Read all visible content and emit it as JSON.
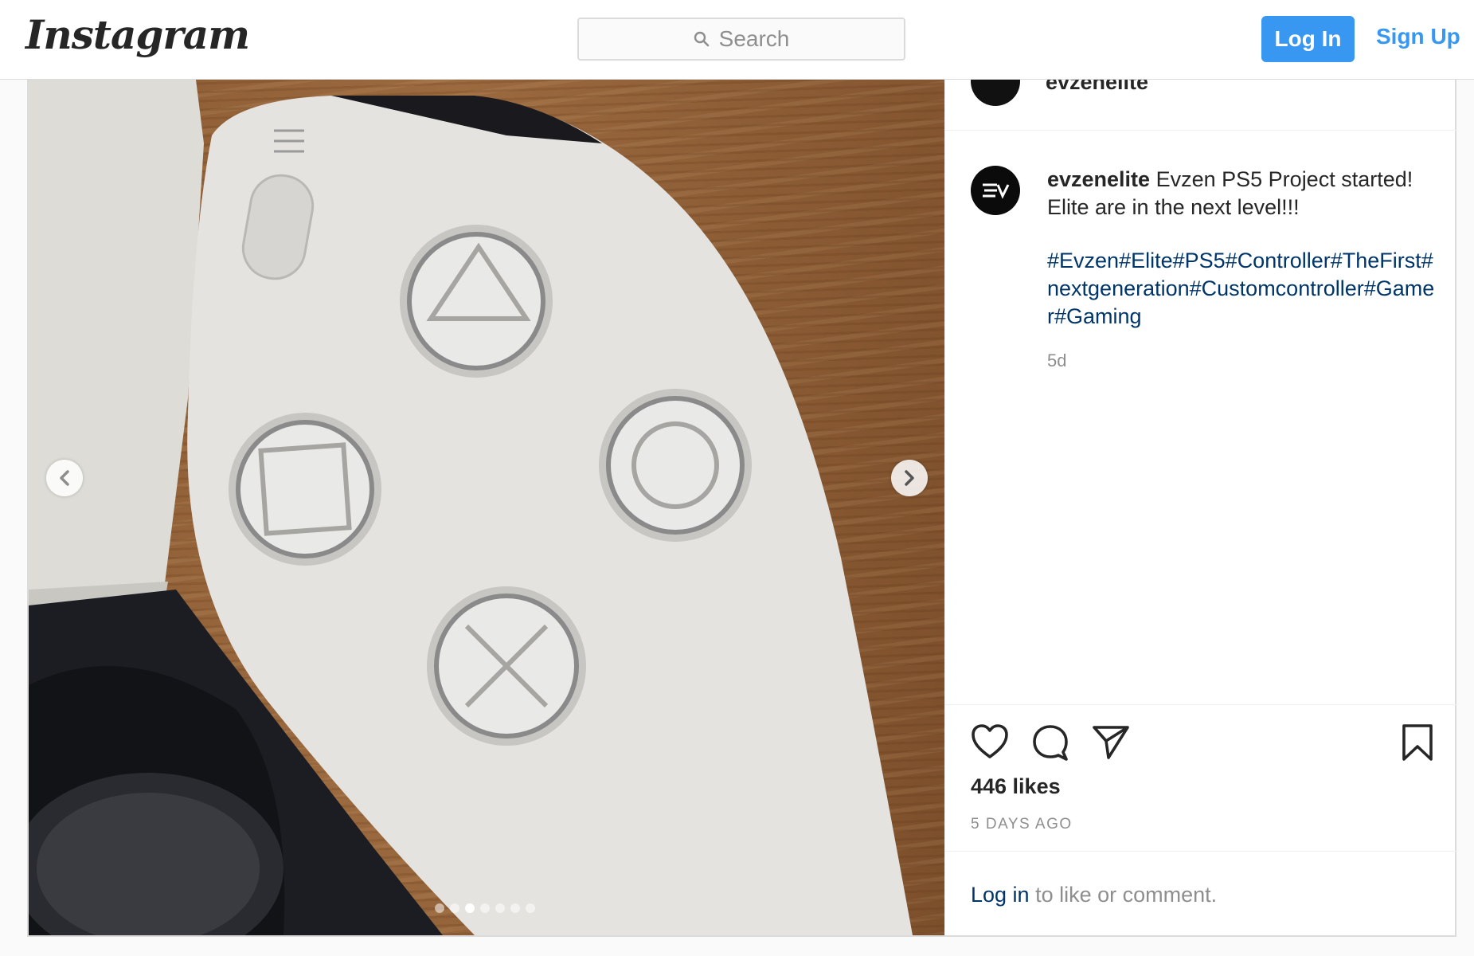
{
  "nav": {
    "logo": "Instagram",
    "search_placeholder": "Search",
    "login_label": "Log In",
    "signup_label": "Sign Up"
  },
  "post": {
    "header_username": "evzenelite",
    "caption": {
      "username": "evzenelite",
      "text": "Evzen PS5 Project started! Elite are in the next level!!!",
      "hashtags": [
        "#Evzen",
        "#Elite",
        "#PS5",
        "#Controller",
        "#TheFirst",
        "#nextgeneration",
        "#Customcontroller",
        "#Gamer",
        "#Gaming"
      ],
      "time": "5d"
    },
    "likes": "446 likes",
    "time_ago": "5 DAYS AGO",
    "login_prompt": {
      "link": "Log in",
      "text": " to like or comment."
    },
    "carousel": {
      "total": 7,
      "active_index": 2
    },
    "icons": {
      "like": "heart-icon",
      "comment": "comment-icon",
      "share": "share-icon",
      "save": "bookmark-icon",
      "prev": "chevron-left-icon",
      "next": "chevron-right-icon",
      "search": "search-icon"
    }
  }
}
